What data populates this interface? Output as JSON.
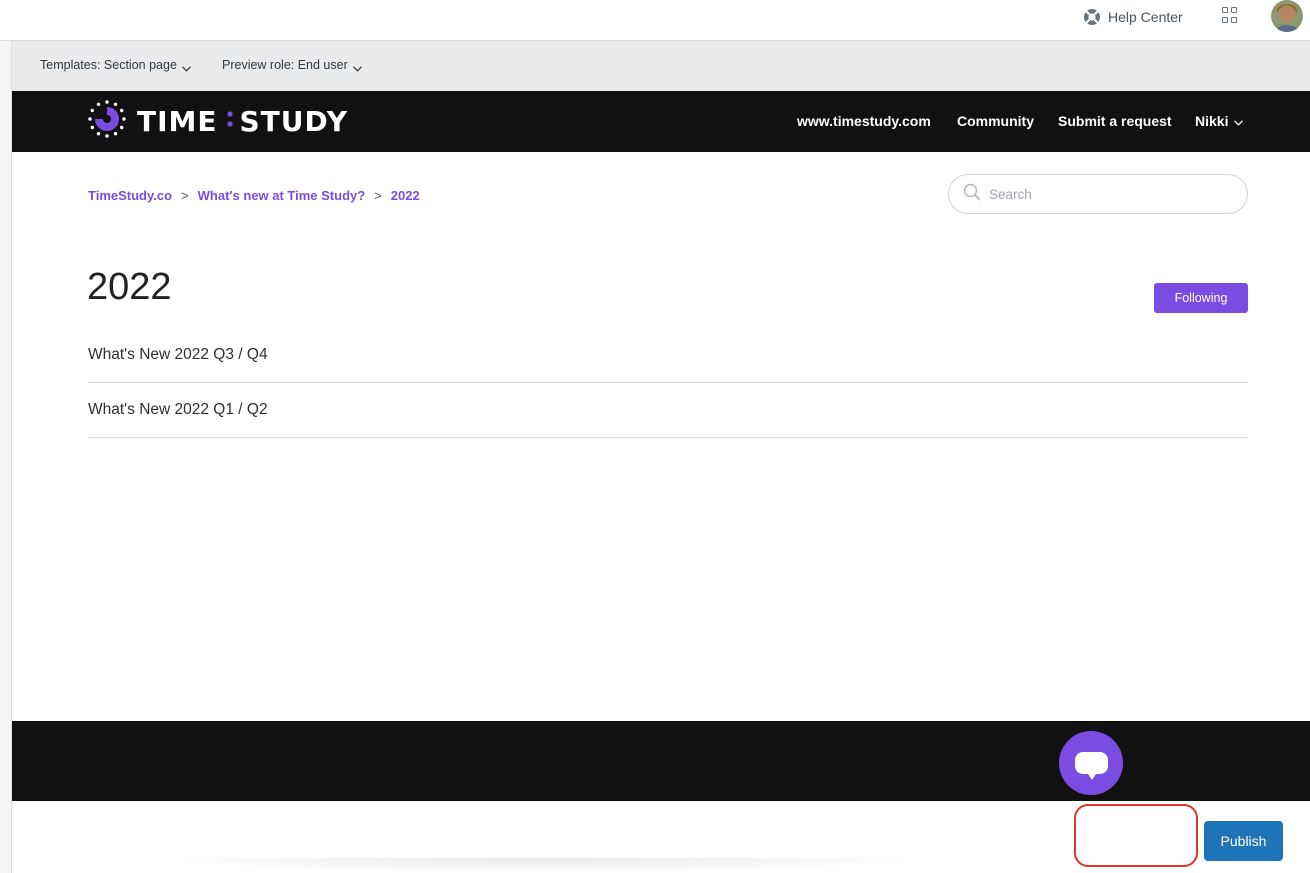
{
  "topbar": {
    "help_center_label": "Help Center",
    "help_icon": "lifebuoy-icon",
    "apps_icon": "grid-icon",
    "avatar_icon": "avatar"
  },
  "preview": {
    "template_label": "Templates: Section page",
    "role_label": "Preview role: End user"
  },
  "site": {
    "logo_left": "TIME",
    "logo_right": "STUDY",
    "nav": {
      "website": "www.timestudy.com",
      "community": "Community",
      "submit": "Submit a request",
      "user": "Nikki"
    }
  },
  "breadcrumb": {
    "items": [
      "TimeStudy.co",
      "What's new at Time Study?",
      "2022"
    ],
    "separator": ">"
  },
  "search": {
    "placeholder": "Search",
    "value": ""
  },
  "section": {
    "title": "2022",
    "follow_label": "Following",
    "articles": [
      "What's New 2022 Q3 / Q4",
      "What's New 2022 Q1 / Q2"
    ]
  },
  "actions": {
    "publish_label": "Publish"
  },
  "colors": {
    "brand_purple": "#7b4ce2",
    "header_bg": "#111111",
    "publish_blue": "#1f73b7",
    "highlight_red": "#d93a2a"
  }
}
